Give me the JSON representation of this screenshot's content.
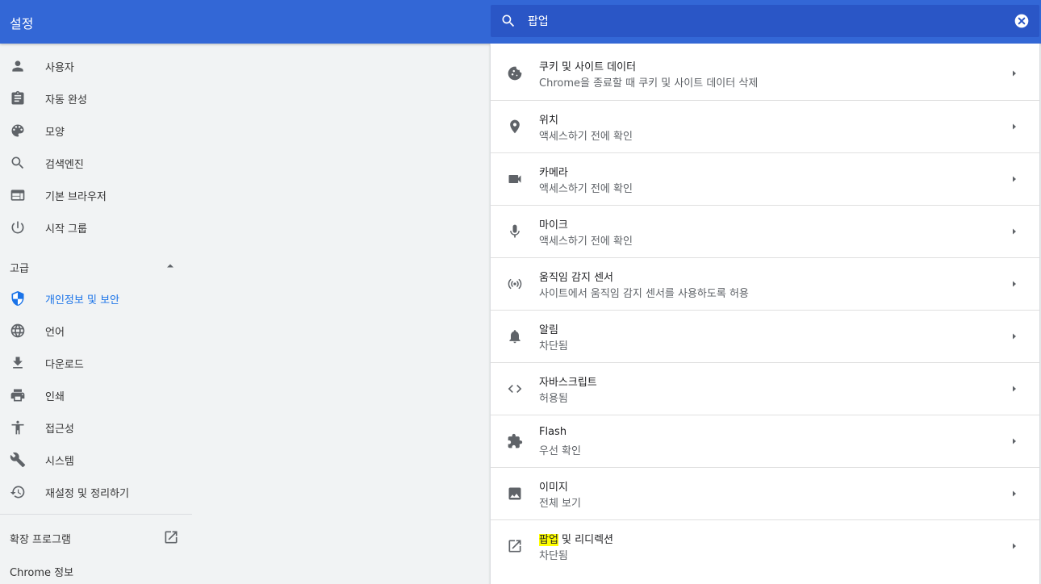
{
  "header": {
    "title": "설정"
  },
  "search": {
    "value": "팝업",
    "icon": "search-icon",
    "clear_icon": "close-icon"
  },
  "sidebar": {
    "items": [
      {
        "label": "사용자",
        "icon": "person-icon"
      },
      {
        "label": "자동 완성",
        "icon": "clipboard-icon"
      },
      {
        "label": "모양",
        "icon": "palette-icon"
      },
      {
        "label": "검색엔진",
        "icon": "search-icon"
      },
      {
        "label": "기본 브라우저",
        "icon": "browser-icon"
      },
      {
        "label": "시작 그룹",
        "icon": "power-icon"
      }
    ],
    "advanced": {
      "label": "고급",
      "icon": "arrow-up-icon"
    },
    "advanced_items": [
      {
        "label": "개인정보 및 보안",
        "icon": "shield-icon",
        "active": true
      },
      {
        "label": "언어",
        "icon": "globe-icon"
      },
      {
        "label": "다운로드",
        "icon": "download-icon"
      },
      {
        "label": "인쇄",
        "icon": "print-icon"
      },
      {
        "label": "접근성",
        "icon": "accessibility-icon"
      },
      {
        "label": "시스템",
        "icon": "wrench-icon"
      },
      {
        "label": "재설정 및 정리하기",
        "icon": "restore-icon"
      }
    ],
    "extensions": {
      "label": "확장 프로그램",
      "icon": "external-link-icon"
    },
    "about": {
      "label": "Chrome 정보"
    }
  },
  "settings": [
    {
      "title": "쿠키 및 사이트 데이터",
      "subtitle": "Chrome을 종료할 때 쿠키 및 사이트 데이터 삭제",
      "icon": "cookie-icon"
    },
    {
      "title": "위치",
      "subtitle": "액세스하기 전에 확인",
      "icon": "location-pin-icon"
    },
    {
      "title": "카메라",
      "subtitle": "액세스하기 전에 확인",
      "icon": "camera-icon"
    },
    {
      "title": "마이크",
      "subtitle": "액세스하기 전에 확인",
      "icon": "microphone-icon"
    },
    {
      "title": "움직임 감지 센서",
      "subtitle": "사이트에서 움직임 감지 센서를 사용하도록 허용",
      "icon": "sensor-icon"
    },
    {
      "title": "알림",
      "subtitle": "차단됨",
      "icon": "bell-icon"
    },
    {
      "title": "자바스크립트",
      "subtitle": "허용됨",
      "icon": "code-icon"
    },
    {
      "title": "Flash",
      "subtitle": "우선 확인",
      "icon": "puzzle-icon"
    },
    {
      "title": "이미지",
      "subtitle": "전체 보기",
      "icon": "image-icon"
    },
    {
      "title_highlight": "팝업",
      "title_rest": " 및 리디렉션",
      "subtitle": "차단됨",
      "icon": "open-in-new-icon"
    }
  ],
  "colors": {
    "header_bg": "#3367d6",
    "search_bg": "#2a56c6",
    "active": "#1a73e8",
    "highlight": "#ffff00"
  }
}
